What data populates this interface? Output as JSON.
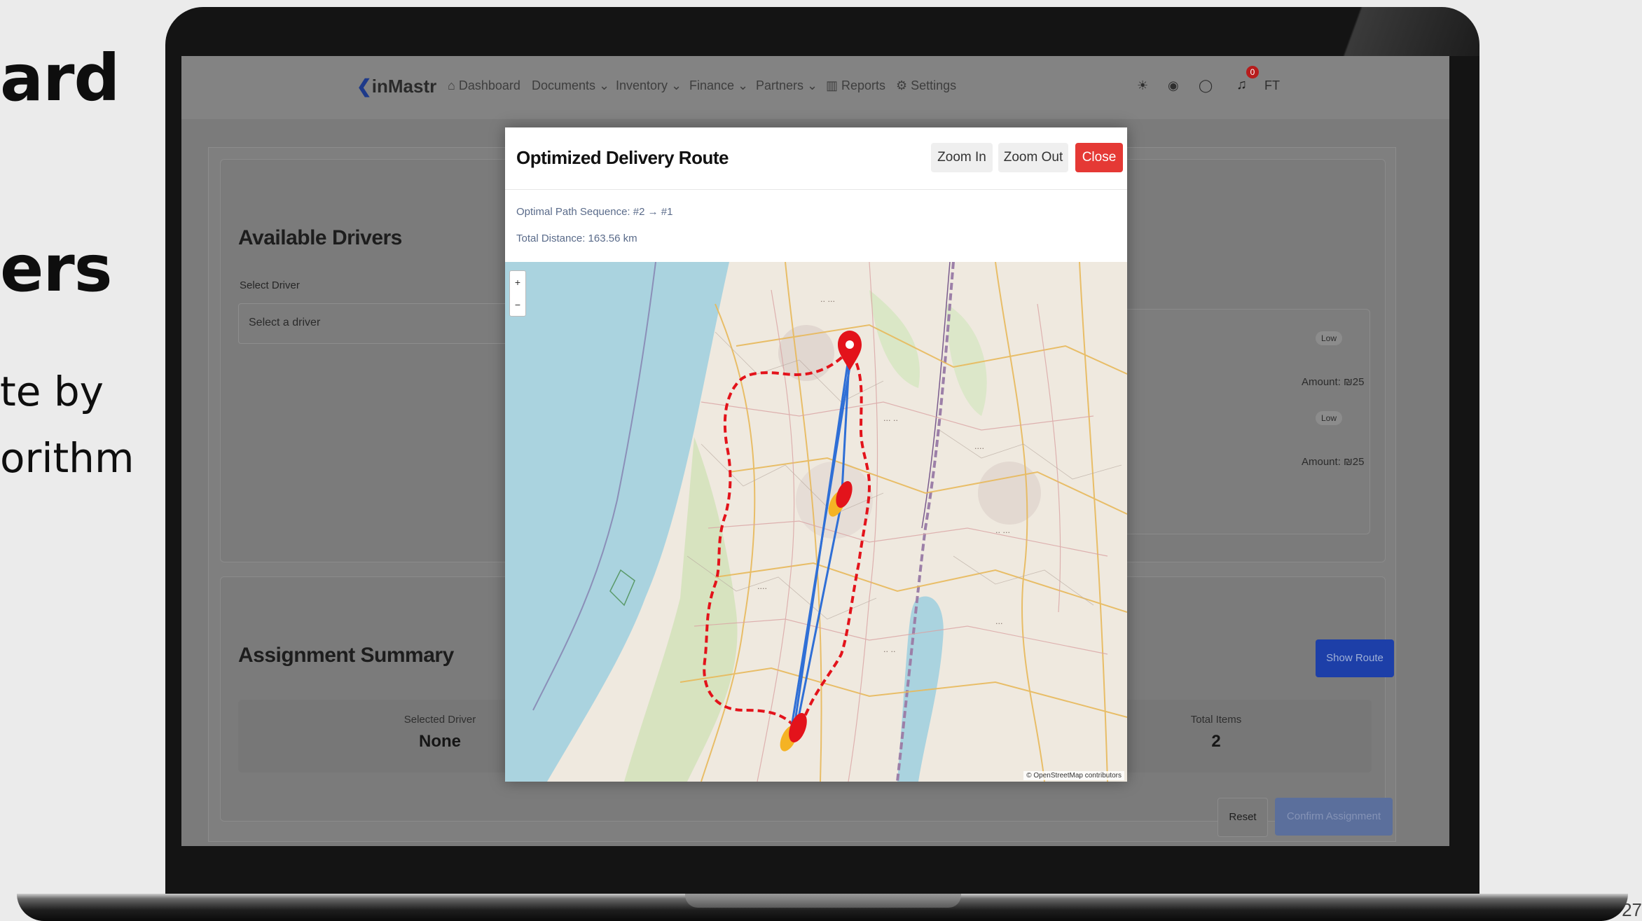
{
  "slide": {
    "heading_1": "ard",
    "heading_2": "ers",
    "body_line_1": "te by",
    "body_line_2": "orithm",
    "corner_number": "27"
  },
  "app": {
    "logo_text": "inMastr",
    "nav_items": [
      "Dashboard",
      "Documents",
      "Inventory",
      "Finance",
      "Partners",
      "Reports",
      "Settings"
    ],
    "notification_count": "0",
    "user_initials": "FT",
    "available_drivers": {
      "title": "Available Drivers",
      "select_label": "Select Driver",
      "select_placeholder": "Select a driver"
    },
    "orders": [
      {
        "priority": "Low",
        "amount": "Amount: ₪25"
      },
      {
        "priority": "Low",
        "amount": "Amount: ₪25"
      }
    ],
    "assignment_summary": {
      "title": "Assignment Summary",
      "selected_driver_label": "Selected Driver",
      "selected_driver_value": "None",
      "total_items_label": "Total Items",
      "total_items_value": "2",
      "show_route_label": "Show Route",
      "reset_label": "Reset",
      "confirm_label": "Confirm Assignment"
    }
  },
  "modal": {
    "title": "Optimized Delivery Route",
    "zoom_in_label": "Zoom In",
    "zoom_out_label": "Zoom Out",
    "close_label": "Close",
    "path_sequence": "Optimal Path Sequence: #2 → #1",
    "total_distance": "Total Distance: 163.56 km",
    "map_zoom_in": "+",
    "map_zoom_out": "−",
    "attribution": "© OpenStreetMap contributors"
  },
  "colors": {
    "route_blue": "#2f6fd6",
    "route_red": "#e3131b",
    "marker_red": "#e3131b",
    "marker_orange": "#f5b324",
    "close_red": "#e53935",
    "sea": "#aad3df",
    "land": "#efe9df"
  }
}
